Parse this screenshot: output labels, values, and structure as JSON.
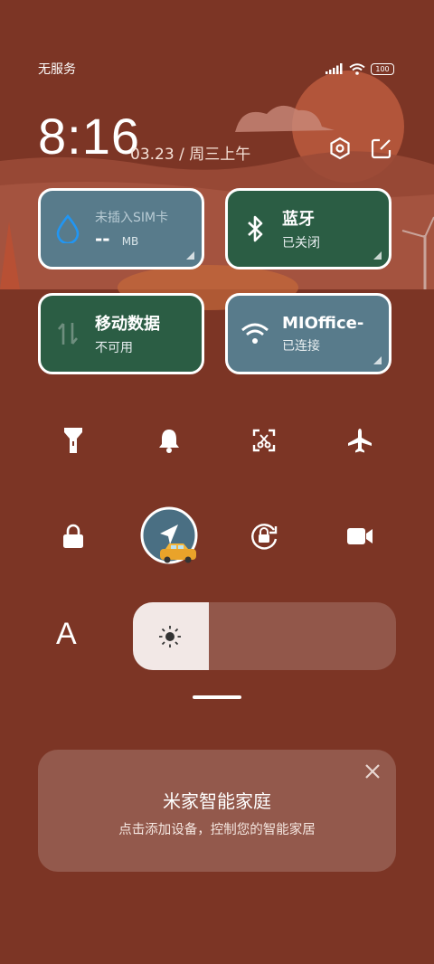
{
  "status_bar": {
    "carrier": "无服务",
    "battery": "100"
  },
  "header": {
    "time": "8:16",
    "date": "03.23 / 周三上午"
  },
  "tiles": {
    "sim": {
      "title": "未插入SIM卡",
      "value": "--",
      "unit": "MB"
    },
    "bluetooth": {
      "title": "蓝牙",
      "status": "已关闭"
    },
    "mobile_data": {
      "title": "移动数据",
      "status": "不可用"
    },
    "wifi": {
      "title": "MIOffice-",
      "status": "已连接"
    }
  },
  "quick_toggles": [
    "flashlight-icon",
    "bell-icon",
    "screenshot-icon",
    "airplane-icon",
    "lock-icon",
    "location-icon",
    "rotation-lock-icon",
    "video-icon"
  ],
  "brightness": {
    "level": 0.29
  },
  "font_label": "A",
  "mijia": {
    "title": "米家智能家庭",
    "subtitle": "点击添加设备，控制您的智能家居"
  },
  "colors": {
    "background": "#7c3525",
    "tile_blue": "#587b8b",
    "tile_green": "#2b5d44",
    "card": "#93594c"
  }
}
